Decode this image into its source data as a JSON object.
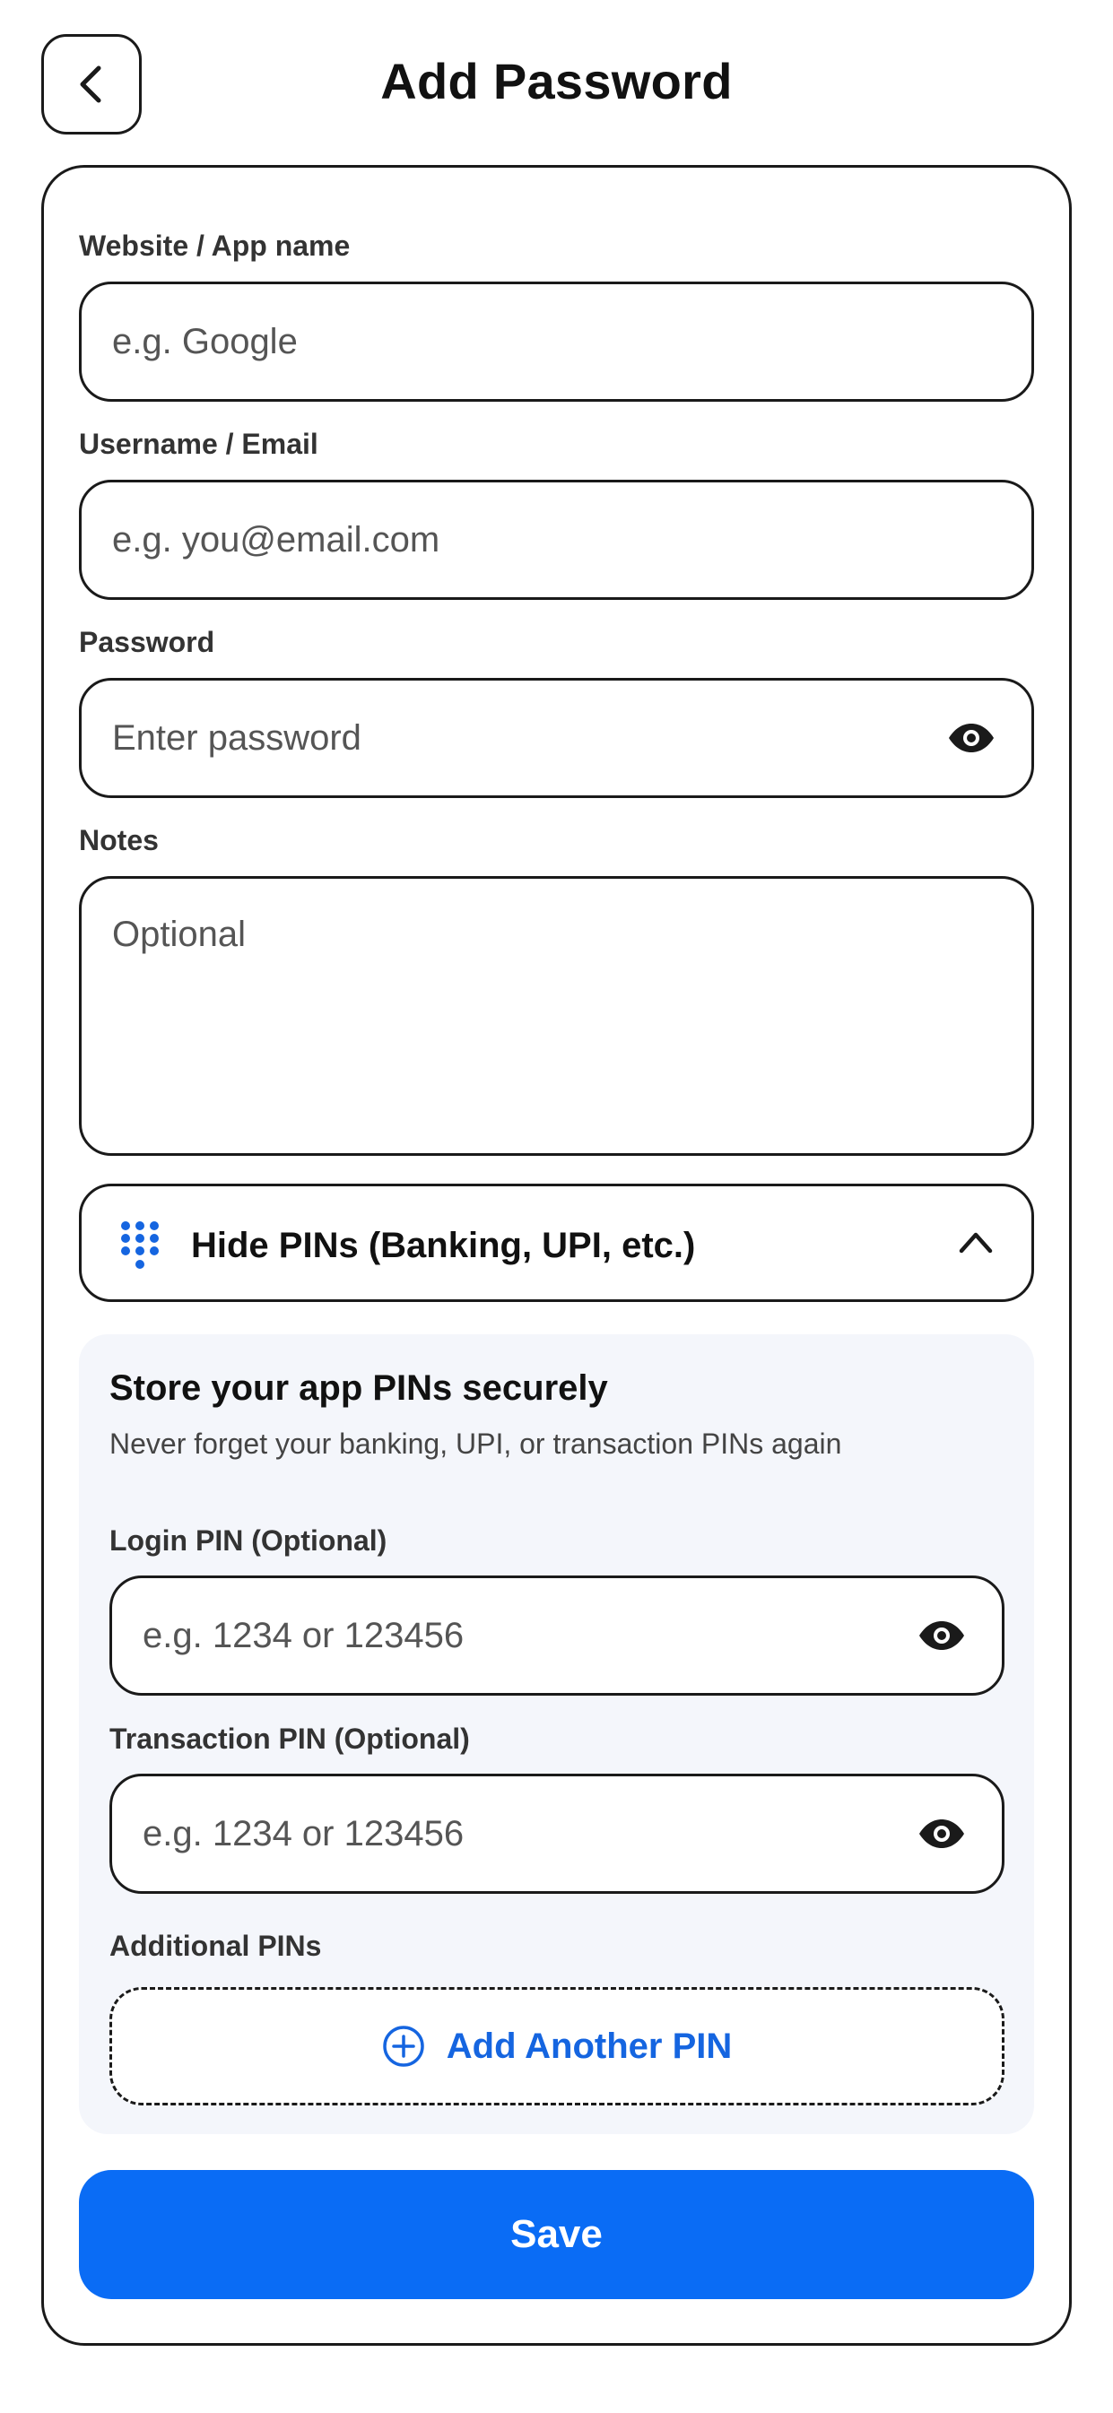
{
  "header": {
    "title": "Add Password"
  },
  "form": {
    "website": {
      "label": "Website / App name",
      "placeholder": "e.g. Google",
      "value": ""
    },
    "username": {
      "label": "Username / Email",
      "placeholder": "e.g. you@email.com",
      "value": ""
    },
    "password": {
      "label": "Password",
      "placeholder": "Enter password",
      "value": ""
    },
    "notes": {
      "label": "Notes",
      "placeholder": "Optional",
      "value": ""
    }
  },
  "pins": {
    "toggle_label": "Hide PINs (Banking, UPI, etc.)",
    "expanded": true,
    "panel_title": "Store your app PINs securely",
    "panel_subtitle": "Never forget your banking, UPI, or transaction PINs again",
    "login_pin": {
      "label": "Login PIN (Optional)",
      "placeholder": "e.g. 1234 or 123456",
      "value": ""
    },
    "transaction_pin": {
      "label": "Transaction PIN (Optional)",
      "placeholder": "e.g. 1234 or 123456",
      "value": ""
    },
    "additional_label": "Additional PINs",
    "add_button_label": "Add Another PIN"
  },
  "actions": {
    "save_label": "Save"
  },
  "icons": {
    "back": "chevron-left-icon",
    "eye": "eye-icon",
    "keypad": "dialpad-icon",
    "collapse": "chevron-up-icon",
    "add": "plus-circle-icon"
  },
  "colors": {
    "accent": "#0a6cf5",
    "link": "#1565e0",
    "panel_bg": "#f4f6fb",
    "border": "#1a1a1a"
  }
}
